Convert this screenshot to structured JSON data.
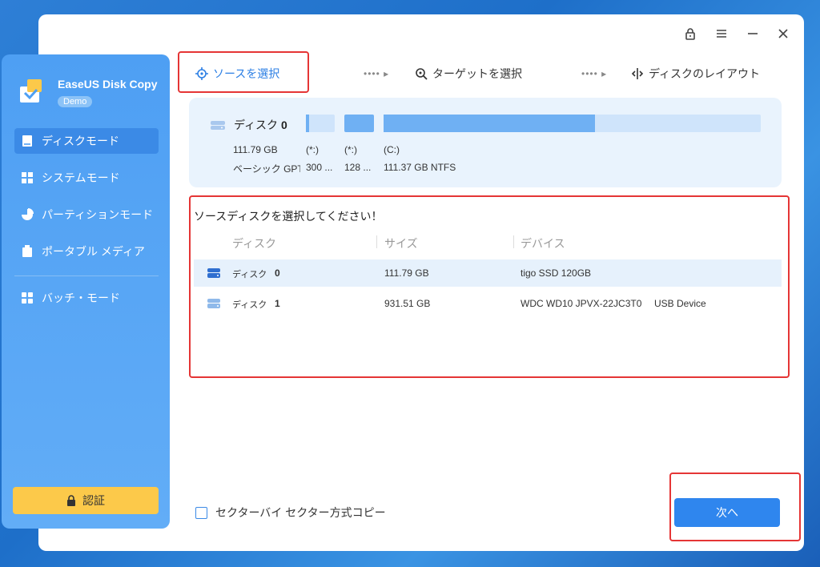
{
  "app": {
    "name": "EaseUS Disk Copy",
    "badge": "Demo"
  },
  "sidebar": {
    "items": [
      {
        "label": "ディスクモード",
        "icon": "disk-mode-icon"
      },
      {
        "label": "システムモード",
        "icon": "windows-icon"
      },
      {
        "label": "パーティションモード",
        "icon": "pie-chart-icon"
      },
      {
        "label": "ポータブル メディア",
        "icon": "portable-media-icon"
      },
      {
        "label": "バッチ・モード",
        "icon": "grid-icon"
      }
    ],
    "auth_label": "認証"
  },
  "steps": [
    {
      "label": "ソースを選択",
      "icon": "crosshair-icon"
    },
    {
      "label": "ターゲットを選択",
      "icon": "target-search-icon"
    },
    {
      "label": "ディスクのレイアウト",
      "icon": "layout-split-icon"
    }
  ],
  "disk_panel": {
    "title": "ディスク",
    "number": "0",
    "capacity": "111.79 GB",
    "type": "ベーシック GPT",
    "partitions": [
      {
        "name": "(*:)",
        "size": "300 ..."
      },
      {
        "name": "(*:)",
        "size": "128 ..."
      },
      {
        "name": "(C:)",
        "size": "111.37 GB NTFS"
      }
    ]
  },
  "source_section": {
    "prompt": "ソースディスクを選択してください！",
    "columns": [
      "ディスク",
      "サイズ",
      "デバイス"
    ],
    "rows": [
      {
        "disk": "ディスク",
        "num": "0",
        "size": "111.79 GB",
        "device": "tigo SSD 120GB",
        "extra": ""
      },
      {
        "disk": "ディスク",
        "num": "1",
        "size": "931.51 GB",
        "device": "WDC WD10 JPVX-22JC3T0",
        "extra": "USB Device"
      }
    ]
  },
  "sector_copy_label": "セクターバイ セクター方式コピー",
  "next_label": "次へ",
  "colors": {
    "accent": "#2f86ee",
    "sidebar": "#4e9ff3",
    "highlight": "#e53535",
    "auth": "#fcc94a"
  }
}
